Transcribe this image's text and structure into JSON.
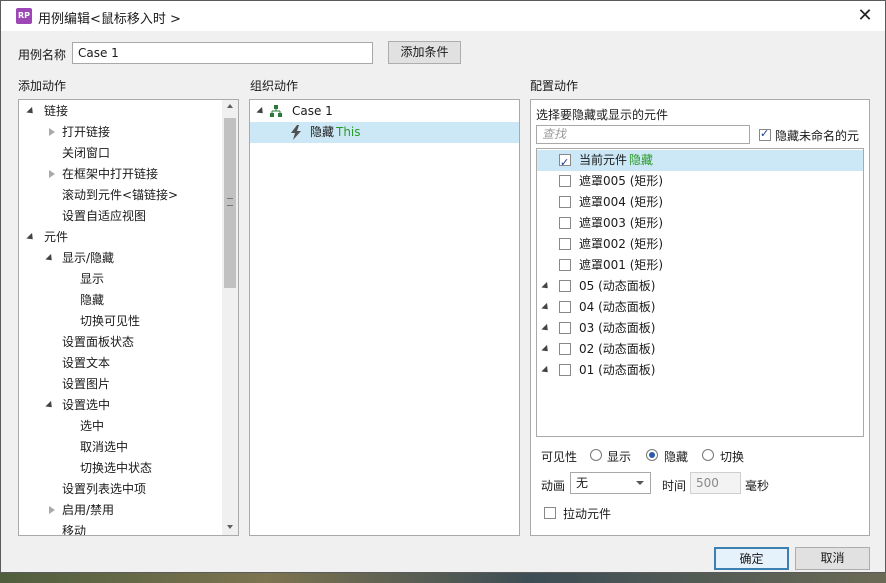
{
  "window": {
    "title": "用例编辑<鼠标移入时 >",
    "close_glyph": "✕",
    "app_icon_text": "RP"
  },
  "case_name": {
    "label": "用例名称",
    "value": "Case 1",
    "add_condition_label": "添加条件"
  },
  "add_actions": {
    "header": "添加动作",
    "items": {
      "links": "链接",
      "open_link": "打开链接",
      "close_window": "关闭窗口",
      "open_in_frame": "在框架中打开链接",
      "scroll_to": "滚动到元件<锚链接>",
      "adaptive_view": "设置自适应视图",
      "widgets": "元件",
      "show_hide": "显示/隐藏",
      "show": "显示",
      "hide": "隐藏",
      "toggle_visibility": "切换可见性",
      "panel_state": "设置面板状态",
      "set_text": "设置文本",
      "set_image": "设置图片",
      "set_selected": "设置选中",
      "select": "选中",
      "deselect": "取消选中",
      "toggle_selected": "切换选中状态",
      "list_selected": "设置列表选中项",
      "enable_disable": "启用/禁用",
      "move": "移动"
    }
  },
  "organize_actions": {
    "header": "组织动作",
    "case_label": "Case 1",
    "action_verb": "隐藏",
    "action_target": "This"
  },
  "configure_actions": {
    "header": "配置动作",
    "subheader": "选择要隐藏或显示的元件",
    "search_placeholder": "查找",
    "hide_unnamed_label": "隐藏未命名的元",
    "hide_unnamed_checked": true,
    "widgets": [
      {
        "label": "当前元件",
        "tag": "隐藏",
        "checked": true,
        "expandable": false
      },
      {
        "label": "遮罩005 (矩形)",
        "tag": "",
        "checked": false,
        "expandable": false
      },
      {
        "label": "遮罩004 (矩形)",
        "tag": "",
        "checked": false,
        "expandable": false
      },
      {
        "label": "遮罩003 (矩形)",
        "tag": "",
        "checked": false,
        "expandable": false
      },
      {
        "label": "遮罩002 (矩形)",
        "tag": "",
        "checked": false,
        "expandable": false
      },
      {
        "label": "遮罩001 (矩形)",
        "tag": "",
        "checked": false,
        "expandable": false
      },
      {
        "label": "05 (动态面板)",
        "tag": "",
        "checked": false,
        "expandable": true
      },
      {
        "label": "04 (动态面板)",
        "tag": "",
        "checked": false,
        "expandable": true
      },
      {
        "label": "03 (动态面板)",
        "tag": "",
        "checked": false,
        "expandable": true
      },
      {
        "label": "02 (动态面板)",
        "tag": "",
        "checked": false,
        "expandable": true
      },
      {
        "label": "01 (动态面板)",
        "tag": "",
        "checked": false,
        "expandable": true
      }
    ],
    "visibility": {
      "label": "可见性",
      "show": "显示",
      "hide": "隐藏",
      "toggle": "切换",
      "selected": "hide"
    },
    "animation": {
      "label": "动画",
      "value": "无",
      "time_label": "时间",
      "time_value": "500",
      "unit": "毫秒"
    },
    "bring_front_label": "拉动元件",
    "bring_front_checked": false
  },
  "footer": {
    "ok_label": "确定",
    "cancel_label": "取消"
  },
  "colors": {
    "selection": "#cce8f6",
    "accent_green": "#2a9a2a",
    "ok_border": "#3c7fb1"
  }
}
